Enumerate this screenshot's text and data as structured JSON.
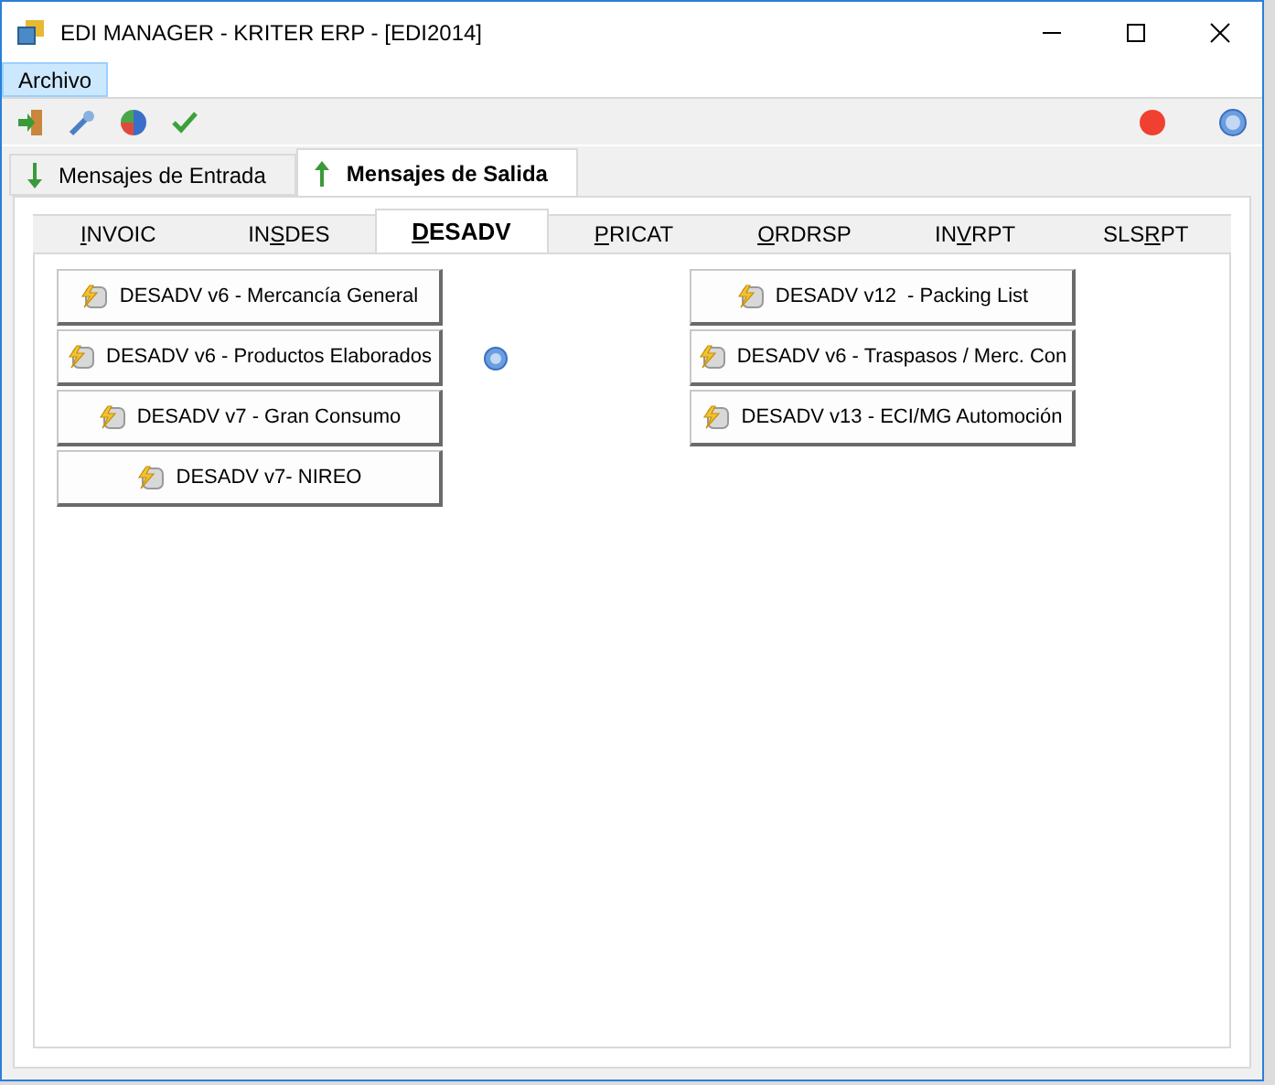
{
  "window": {
    "title": "EDI MANAGER - KRITER ERP - [EDI2014]"
  },
  "menu": [
    {
      "label": "Archivo",
      "selected": true
    }
  ],
  "outer_tabs": [
    {
      "label": "Mensajes de Entrada",
      "selected": false,
      "kind": "down"
    },
    {
      "label": "Mensajes de Salida",
      "selected": true,
      "kind": "up"
    }
  ],
  "inner_tabs": [
    {
      "hotkey": "I",
      "after": "NVOIC",
      "selected": false
    },
    {
      "before": "IN",
      "hotkey": "S",
      "after": "DES",
      "selected": false
    },
    {
      "hotkey": "D",
      "after": "ESADV",
      "selected": true
    },
    {
      "hotkey": "P",
      "after": "RICAT",
      "selected": false
    },
    {
      "hotkey": "O",
      "after": "RDRSP",
      "selected": false
    },
    {
      "before": "IN",
      "hotkey": "V",
      "after": "RPT",
      "selected": false
    },
    {
      "before": "SLS",
      "hotkey": "R",
      "after": "PT",
      "selected": false
    }
  ],
  "left_buttons": [
    "DESADV v6 - Mercancía General",
    "DESADV v6 - Productos Elaborados",
    "DESADV v7 - Gran Consumo",
    "DESADV v7- NIREO"
  ],
  "right_buttons": [
    "DESADV v12  - Packing List",
    "DESADV v6 - Traspasos / Merc. Con",
    "DESADV v13 - ECI/MG Automoción"
  ]
}
